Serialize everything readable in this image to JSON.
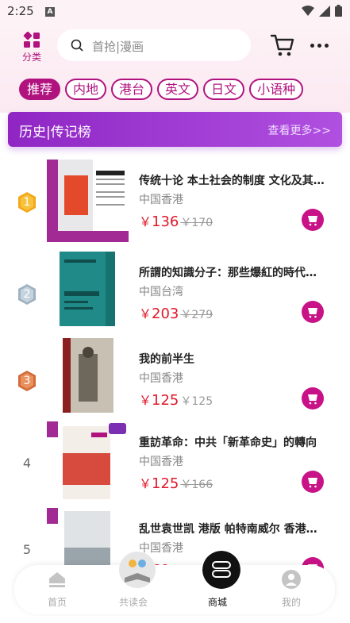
{
  "status_bar": {
    "time": "2:25",
    "notif_letter": "A"
  },
  "header": {
    "category_label": "分类",
    "search_placeholder": "首抢|漫画",
    "tabs": [
      {
        "label": "推荐",
        "active": true
      },
      {
        "label": "内地",
        "active": false
      },
      {
        "label": "港台",
        "active": false
      },
      {
        "label": "英文",
        "active": false
      },
      {
        "label": "日文",
        "active": false
      },
      {
        "label": "小语种",
        "active": false
      }
    ]
  },
  "section": {
    "title": "历史|传记榜",
    "more_label": "查看更多>>"
  },
  "books": [
    {
      "rank": "1",
      "title": "传统十论 本土社会的制度 文化及其…",
      "origin": "中国香港",
      "price": "136",
      "old_price": "170",
      "yen": "￥",
      "badge": "gold"
    },
    {
      "rank": "2",
      "title": "所謂的知識分子：那些爆紅的時代…",
      "origin": "中国台湾",
      "price": "203",
      "old_price": "279",
      "yen": "￥",
      "badge": "silver"
    },
    {
      "rank": "3",
      "title": "我的前半生",
      "origin": "中国香港",
      "price": "125",
      "old_price": "125",
      "yen": "￥",
      "badge": "bronze"
    },
    {
      "rank": "4",
      "title": "重訪革命：中共「新革命史」的轉向",
      "origin": "中国香港",
      "price": "125",
      "old_price": "166",
      "yen": "￥",
      "badge": "none"
    },
    {
      "rank": "5",
      "title": "乱世袁世凯 港版 帕特南威尔 香港…",
      "origin": "中国香港",
      "price": "69",
      "old_price": "107",
      "yen": "￥",
      "badge": "none"
    }
  ],
  "bottom_nav": [
    {
      "label": "首页",
      "active": false
    },
    {
      "label": "共读会",
      "active": false
    },
    {
      "label": "商城",
      "active": true
    },
    {
      "label": "我的",
      "active": false
    }
  ],
  "colors": {
    "accent": "#b0127e",
    "price": "#e0182a",
    "section_bg": "#9a33cf"
  }
}
